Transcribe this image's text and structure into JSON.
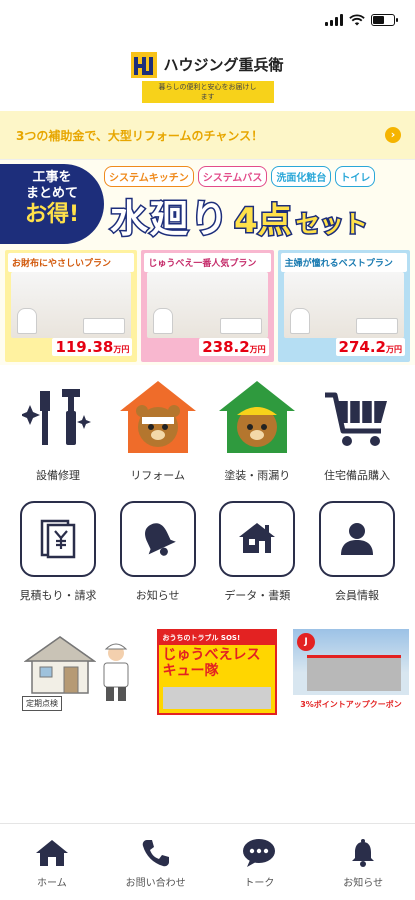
{
  "header": {
    "brand": "ハウジング重兵衛",
    "tagline": "暮らしの便利と安心をお届けします"
  },
  "campaign": {
    "text": "3つの補助金で、大型リフォームのチャンス！"
  },
  "banner": {
    "badge_line1": "工事を",
    "badge_line2": "まとめて",
    "badge_line3": "お得!",
    "tags": [
      "システムキッチン",
      "システムバス",
      "洗面化粧台",
      "トイレ"
    ],
    "headline_main": "水廻り",
    "headline_count": "4点",
    "headline_suffix": "セット",
    "plans": [
      {
        "title": "お財布にやさしいプラン",
        "price": "119.38",
        "unit": "万円"
      },
      {
        "title": "じゅうべえ一番人気プラン",
        "price": "238.2",
        "unit": "万円"
      },
      {
        "title": "主婦が憧れるベストプラン",
        "price": "274.2",
        "unit": "万円"
      }
    ]
  },
  "menu_row1": [
    {
      "label": "設備修理",
      "icon": "tools-icon"
    },
    {
      "label": "リフォーム",
      "icon": "bear-mascot-icon"
    },
    {
      "label": "塗装・雨漏り",
      "icon": "bear-paint-icon"
    },
    {
      "label": "住宅備品購入",
      "icon": "cart-icon"
    }
  ],
  "menu_row2": [
    {
      "label": "見積もり・請求",
      "icon": "yen-document-icon"
    },
    {
      "label": "お知らせ",
      "icon": "bell-icon"
    },
    {
      "label": "データ・書類",
      "icon": "house-icon"
    },
    {
      "label": "会員情報",
      "icon": "person-icon"
    }
  ],
  "promos": {
    "promo1_caption": "定期点検",
    "promo2_top": "おうちのトラブル SOS!",
    "promo2_big": "じゅうべえレスキュー隊",
    "promo3_caption": "3%ポイントアップクーポン"
  },
  "tabbar": [
    {
      "label": "ホーム",
      "icon": "home-icon"
    },
    {
      "label": "お問い合わせ",
      "icon": "phone-icon"
    },
    {
      "label": "トーク",
      "icon": "chat-icon"
    },
    {
      "label": "お知らせ",
      "icon": "bell-icon"
    }
  ],
  "colors": {
    "accent_yellow": "#f7d21a",
    "navy": "#1d2e7b",
    "campaign_text": "#e7a600",
    "icon_dark": "#2a2e4a"
  }
}
